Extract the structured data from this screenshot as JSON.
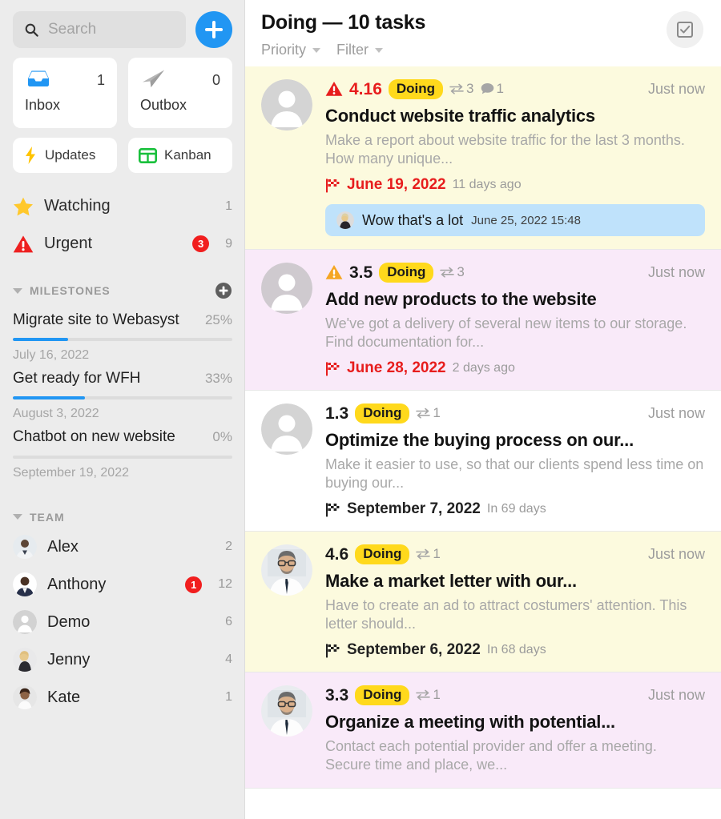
{
  "sidebar": {
    "search": {
      "placeholder": "Search",
      "value": "",
      "icon": "search-icon"
    },
    "add_button": {
      "icon": "plus-icon",
      "label": ""
    },
    "boxes": [
      {
        "name": "Inbox",
        "count": "1",
        "icon": "inbox-icon"
      },
      {
        "name": "Outbox",
        "count": "0",
        "icon": "paper-plane-icon"
      }
    ],
    "shortcuts": [
      {
        "label": "Updates",
        "icon": "lightning-bolt-icon"
      },
      {
        "label": "Kanban",
        "icon": "kanban-grid-icon"
      }
    ],
    "nav": [
      {
        "label": "Watching",
        "icon": "star-icon",
        "count": "1",
        "badge": ""
      },
      {
        "label": "Urgent",
        "icon": "warning-triangle-icon",
        "count": "9",
        "badge": "3"
      }
    ],
    "milestones_section": {
      "title": "MILESTONES",
      "add_icon": "plus-circle-icon",
      "caret": "caret-down-icon"
    },
    "milestones": [
      {
        "name": "Migrate site to Webasyst",
        "percent": "25%",
        "progress": 25,
        "date": "July 16, 2022"
      },
      {
        "name": "Get ready for WFH",
        "percent": "33%",
        "progress": 33,
        "date": "August 3, 2022"
      },
      {
        "name": "Chatbot on new website",
        "percent": "0%",
        "progress": 0,
        "date": "September 19, 2022"
      }
    ],
    "team_section": {
      "title": "TEAM",
      "caret": "caret-down-icon"
    },
    "team": [
      {
        "name": "Alex",
        "count": "2",
        "badge": "",
        "avatar": "photo-male-asian"
      },
      {
        "name": "Anthony",
        "count": "12",
        "badge": "1",
        "avatar": "photo-male-beard"
      },
      {
        "name": "Demo",
        "count": "6",
        "badge": "",
        "avatar": "default-person-icon"
      },
      {
        "name": "Jenny",
        "count": "4",
        "badge": "",
        "avatar": "photo-female-blonde"
      },
      {
        "name": "Kate",
        "count": "1",
        "badge": "",
        "avatar": "photo-female-dark"
      }
    ]
  },
  "main": {
    "title": "Doing — 10 tasks",
    "filters": [
      {
        "label": "Priority",
        "icon": "chevron-down-icon"
      },
      {
        "label": "Filter",
        "icon": "chevron-down-icon"
      }
    ],
    "header_action": {
      "icon": "checkbox-checked-icon"
    },
    "tasks": [
      {
        "bg": "bg-yellow",
        "avatar": "default-person-icon",
        "priority": "4.16",
        "priority_color": "red",
        "priority_icon": "warning-triangle-red-icon",
        "status": "Doing",
        "counters": [
          {
            "icon": "transfer-arrows-icon",
            "value": "3"
          },
          {
            "icon": "comment-bubble-icon",
            "value": "1"
          }
        ],
        "updated": "Just now",
        "title": "Conduct website traffic analytics",
        "description": "Make a report about website traffic for the last 3 months. How many unique...",
        "due_icon": "checkered-flag-red-icon",
        "due_date": "June 19, 2022",
        "due_color": "red",
        "due_relative": "11 days ago",
        "comment": {
          "avatar": "photo-female-blonde",
          "text": "Wow that's a lot",
          "time": "June 25, 2022 15:48"
        }
      },
      {
        "bg": "bg-pink",
        "avatar": "default-person-icon",
        "priority": "3.5",
        "priority_color": "dark",
        "priority_icon": "warning-triangle-amber-icon",
        "status": "Doing",
        "counters": [
          {
            "icon": "transfer-arrows-icon",
            "value": "3"
          }
        ],
        "updated": "Just now",
        "title": "Add new products to the website",
        "description": "We've got a delivery of several new items to our storage. Find documentation for...",
        "due_icon": "checkered-flag-red-icon",
        "due_date": "June 28, 2022",
        "due_color": "red",
        "due_relative": "2 days ago",
        "comment": null
      },
      {
        "bg": "bg-white",
        "avatar": "default-person-icon",
        "priority": "1.3",
        "priority_color": "dark",
        "priority_icon": "",
        "status": "Doing",
        "counters": [
          {
            "icon": "transfer-arrows-icon",
            "value": "1"
          }
        ],
        "updated": "Just now",
        "title": "Optimize the buying process on our...",
        "description": "Make it easier to use, so that our clients spend less time on buying our...",
        "due_icon": "checkered-flag-dark-icon",
        "due_date": "September 7, 2022",
        "due_color": "dark",
        "due_relative": "In 69 days",
        "comment": null
      },
      {
        "bg": "bg-yellow",
        "avatar": "photo-male-glasses",
        "priority": "4.6",
        "priority_color": "dark",
        "priority_icon": "",
        "status": "Doing",
        "counters": [
          {
            "icon": "transfer-arrows-icon",
            "value": "1"
          }
        ],
        "updated": "Just now",
        "title": "Make a market letter with our...",
        "description": "Have to create an ad to attract costumers' attention. This letter should...",
        "due_icon": "checkered-flag-dark-icon",
        "due_date": "September 6, 2022",
        "due_color": "dark",
        "due_relative": "In 68 days",
        "comment": null
      },
      {
        "bg": "bg-pink",
        "avatar": "photo-male-glasses",
        "priority": "3.3",
        "priority_color": "dark",
        "priority_icon": "",
        "status": "Doing",
        "counters": [
          {
            "icon": "transfer-arrows-icon",
            "value": "1"
          }
        ],
        "updated": "Just now",
        "title": "Organize a meeting with potential...",
        "description": "Contact each potential provider and offer a meeting. Secure time and place, we...",
        "due_icon": "",
        "due_date": "",
        "due_color": "dark",
        "due_relative": "",
        "comment": null
      }
    ]
  },
  "colors": {
    "accent_blue": "#2196f3",
    "badge_red": "#f11e1e",
    "status_yellow": "#ffd91c",
    "card_yellow": "#fcfade",
    "card_pink": "#f9eaf9",
    "comment_blue": "#bfe2fb",
    "sidebar_gray": "#ececec"
  }
}
